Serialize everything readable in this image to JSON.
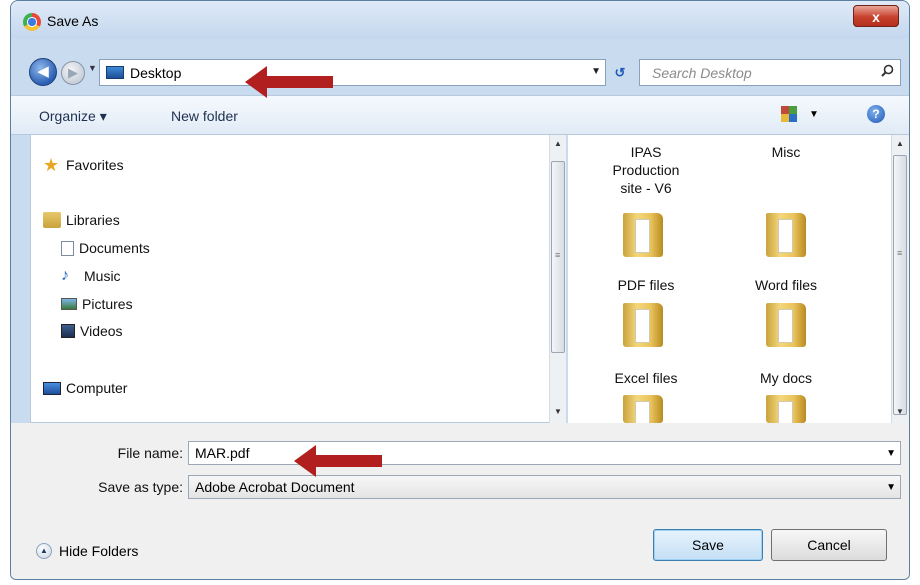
{
  "window": {
    "title": "Save As",
    "close_glyph": "x"
  },
  "address": {
    "location": "Desktop",
    "search_placeholder": "Search Desktop"
  },
  "toolbar": {
    "organize": "Organize ▾",
    "new_folder": "New folder"
  },
  "nav": {
    "favorites": "Favorites",
    "libraries": "Libraries",
    "documents": "Documents",
    "music": "Music",
    "pictures": "Pictures",
    "videos": "Videos",
    "computer": "Computer"
  },
  "files": [
    {
      "name": "IPAS Production site - V6"
    },
    {
      "name": "Misc"
    },
    {
      "name": "PDF files"
    },
    {
      "name": "Word files"
    },
    {
      "name": "Excel files"
    },
    {
      "name": "My docs"
    }
  ],
  "form": {
    "file_name_label": "File name:",
    "file_name_value": "MAR.pdf",
    "save_type_label": "Save as type:",
    "save_type_value": "Adobe Acrobat Document"
  },
  "footer": {
    "hide_folders": "Hide Folders",
    "save": "Save",
    "cancel": "Cancel"
  },
  "colors": {
    "annotation_arrow": "#b11f1f",
    "title_bar": "#c9dbef"
  },
  "icons": [
    "back-icon",
    "forward-icon",
    "desktop-icon",
    "refresh-icon",
    "search-icon",
    "view-icon",
    "help-icon",
    "star-icon",
    "library-icon",
    "document-icon",
    "music-icon",
    "pictures-icon",
    "videos-icon",
    "computer-icon",
    "folder-icon"
  ]
}
